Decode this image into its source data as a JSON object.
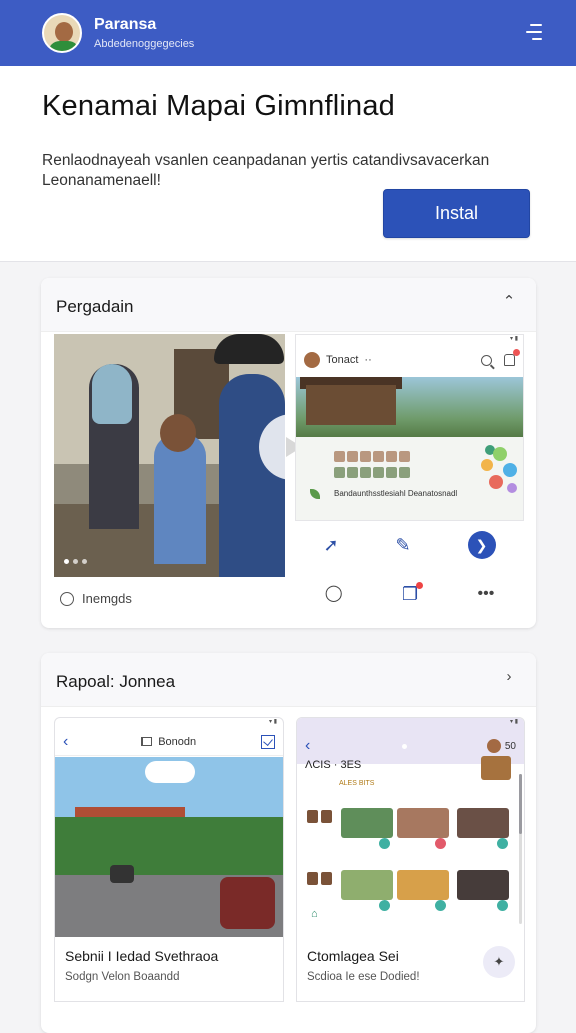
{
  "header": {
    "app_name": "Paransa",
    "app_subtitle": "Abdedenoggegecies",
    "menu_icon": "menu-icon",
    "background": "#3d5cc4"
  },
  "hero": {
    "title": "Kenamai Mapai Gimnflinad",
    "description": "Renlaodnayeah vsanlen ceanpadanan yertis catandivsavacerkan Leonanamenaell!",
    "install_label": "Instal",
    "accent": "#2c52b8"
  },
  "gallery": {
    "title": "Pergadain",
    "collapse_icon": "chevron-up-icon",
    "video_label": "Inemgds",
    "screenshot_1": {
      "app_label": "Tonact",
      "panel_text": "Bandaunthsstlesiahl Deanatosnadl"
    }
  },
  "related": {
    "title": "Rapoal: Jonnea",
    "arrow_icon": "chevron-right-icon",
    "items": [
      {
        "nav_label": "Bonodn",
        "title": "Sebnii I Iedad Svethraoa",
        "subtitle": "Sodgn Velon Boaandd"
      },
      {
        "nav_label": "ΛCIS · 3ES",
        "badge_number": "50",
        "header_sub": "ALES BITS",
        "title": "Ctomlagea Sei",
        "subtitle": "Scdioa Ie ese Dodied!"
      }
    ]
  }
}
